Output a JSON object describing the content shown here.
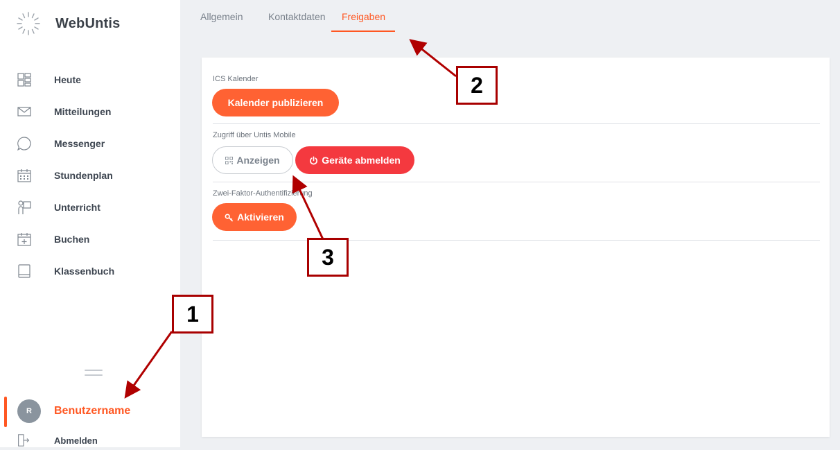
{
  "app": {
    "name": "WebUntis"
  },
  "sidebar": {
    "items": [
      {
        "label": "Heute",
        "icon": "dashboard-icon"
      },
      {
        "label": "Mitteilungen",
        "icon": "envelope-icon"
      },
      {
        "label": "Messenger",
        "icon": "chat-bubble-icon"
      },
      {
        "label": "Stundenplan",
        "icon": "calendar-grid-icon"
      },
      {
        "label": "Unterricht",
        "icon": "teacher-board-icon"
      },
      {
        "label": "Buchen",
        "icon": "calendar-plus-icon"
      },
      {
        "label": "Klassenbuch",
        "icon": "book-icon"
      }
    ],
    "user": {
      "initial": "R",
      "name": "Benutzername"
    },
    "logout_label": "Abmelden"
  },
  "tabs": [
    {
      "label": "Allgemein",
      "active": false
    },
    {
      "label": "Kontaktdaten",
      "active": false
    },
    {
      "label": "Freigaben",
      "active": true
    }
  ],
  "sections": {
    "ics": {
      "label": "ICS Kalender",
      "button": "Kalender publizieren"
    },
    "mobile": {
      "label": "Zugriff über Untis Mobile",
      "show_button": "Anzeigen",
      "logout_devices_button": "Geräte abmelden"
    },
    "twofa": {
      "label": "Zwei-Faktor-Authentifizierung",
      "button": "Aktivieren"
    }
  },
  "annotations": [
    "1",
    "2",
    "3"
  ],
  "colors": {
    "accent": "#ff5722",
    "button_orange": "#ff6233",
    "button_red": "#f4393f",
    "annotation": "#a80000"
  }
}
